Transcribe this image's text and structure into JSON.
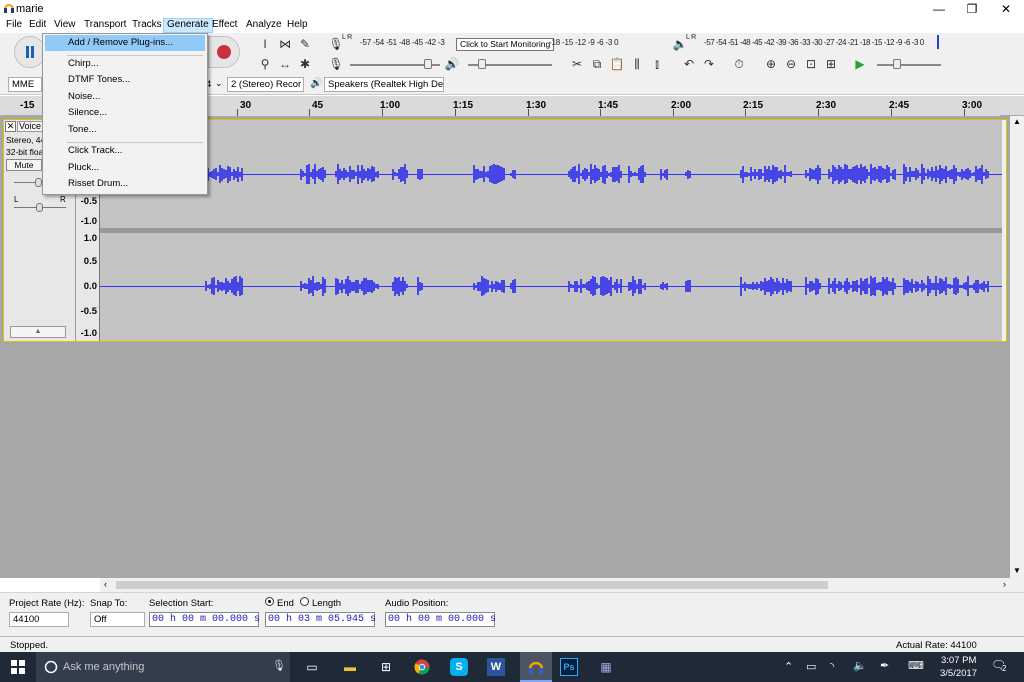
{
  "window": {
    "title": "marie"
  },
  "menu": [
    "File",
    "Edit",
    "View",
    "Transport",
    "Tracks",
    "Generate",
    "Effect",
    "Analyze",
    "Help"
  ],
  "generate_menu": {
    "groups": [
      [
        "Add / Remove Plug-ins..."
      ],
      [
        "Chirp...",
        "DTMF Tones...",
        "Noise...",
        "Silence...",
        "Tone..."
      ],
      [
        "Click Track...",
        "Pluck...",
        "Risset Drum..."
      ]
    ],
    "highlighted": "Add / Remove Plug-ins..."
  },
  "meters": {
    "record_scale": "-57 -54 -51 -48 -45 -42 -3",
    "record_scale_tail": "-18 -15 -12  -9  -6  -3  0",
    "monitor_tooltip": "Click to Start Monitoring",
    "playback_scale": "-57 -54 -51 -48 -45 -42 -39 -36 -33 -30 -27 -24 -21 -18 -15 -12  -9  -6  -3  0",
    "record_lr": "L R",
    "play_lr": "L R"
  },
  "device_toolbar": {
    "host": "MME",
    "input_channels": "2 (Stereo) Recor",
    "output_device": "Speakers (Realtek High De",
    "left_fragment": "4"
  },
  "ruler": {
    "left_value": "-15",
    "labels": [
      "30",
      "45",
      "1:00",
      "1:15",
      "1:30",
      "1:45",
      "2:00",
      "2:15",
      "2:30",
      "2:45",
      "3:00"
    ]
  },
  "track": {
    "name": "Voice",
    "info_line1": "Stereo, 44",
    "info_line2": "32-bit floa",
    "mute_label": "Mute",
    "pan_l": "L",
    "pan_r": "R",
    "collapse_glyph": "▲",
    "close_glyph": "✕",
    "scale_ch1": [
      "-0.5",
      "-1.0"
    ],
    "scale_ch2": [
      "1.0",
      "0.5",
      "0.0",
      "-0.5",
      "-1.0"
    ],
    "waveform_color": "#4646e6"
  },
  "selection_bar": {
    "project_rate_label": "Project Rate (Hz):",
    "project_rate": "44100",
    "snap_to_label": "Snap To:",
    "snap_to": "Off",
    "selection_start_label": "Selection Start:",
    "selection_start": "00 h 00 m 00.000 s",
    "end_label": "End",
    "length_label": "Length",
    "end_value": "00 h 03 m 05.945 s",
    "audio_position_label": "Audio Position:",
    "audio_position": "00 h 00 m 00.000 s"
  },
  "status": {
    "left": "Stopped.",
    "right": "Actual Rate: 44100"
  },
  "taskbar": {
    "search_placeholder": "Ask me anything",
    "time": "3:07 PM",
    "date": "3/5/2017",
    "notification_count": "2"
  }
}
